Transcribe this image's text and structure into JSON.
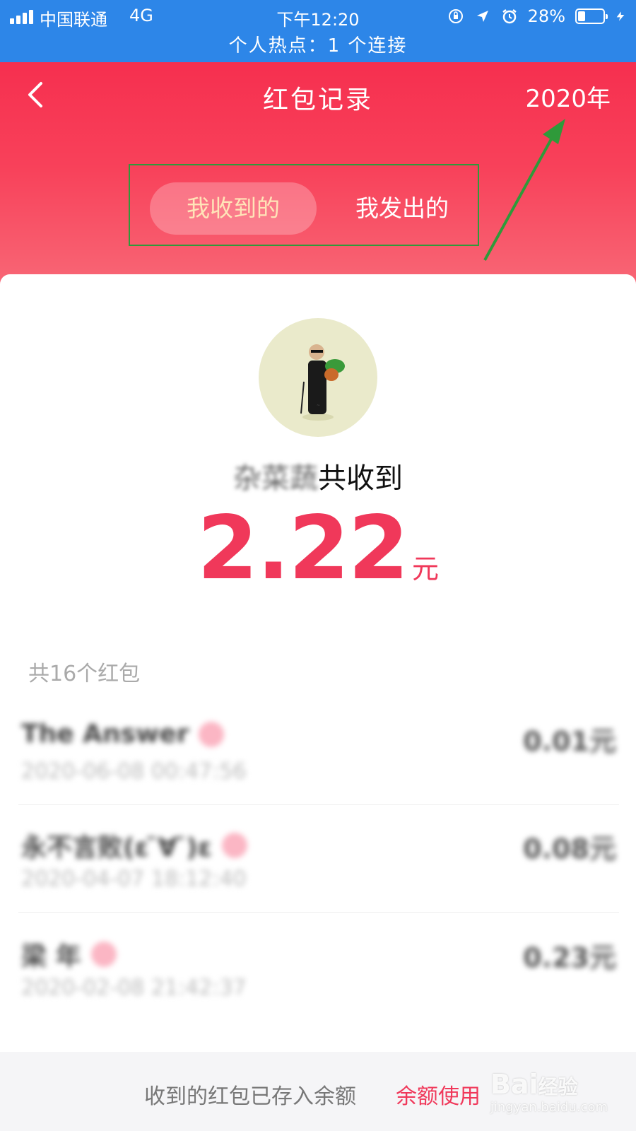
{
  "status_bar": {
    "carrier": "中国联通",
    "network": "4G",
    "time": "下午12:20",
    "battery": "28%",
    "battery_level": 0.28,
    "hotspot": "个人热点：1 个连接"
  },
  "header": {
    "title": "红包记录",
    "year": "2020年",
    "tabs": [
      "我收到的",
      "我发出的"
    ],
    "active_tab": 0
  },
  "summary": {
    "name_blurred": "杂菜蔬",
    "received_label": "共收到",
    "amount": "2.22",
    "unit": "元",
    "count": "共16个红包"
  },
  "records": [
    {
      "name": "The Answer",
      "time": "2020-06-08 00:47:56",
      "amount": "0.01元"
    },
    {
      "name": "永不言败(ε ̄∀ ̄)ε",
      "time": "2020-04-07 18:12:40",
      "amount": "0.08元"
    },
    {
      "name": "梁 年",
      "time": "2020-02-08 21:42:37",
      "amount": "0.23元"
    }
  ],
  "footer": {
    "text": "收到的红包已存入余额",
    "link": "余额使用"
  },
  "watermark": {
    "main": "Bai",
    "main2": "经验",
    "sub": "jingyan.baidu.com"
  },
  "colors": {
    "status_blue": "#2d86e8",
    "header_red": "#f62f4f",
    "amount_red": "#f0385a",
    "highlight_green": "#2f9a3a"
  }
}
